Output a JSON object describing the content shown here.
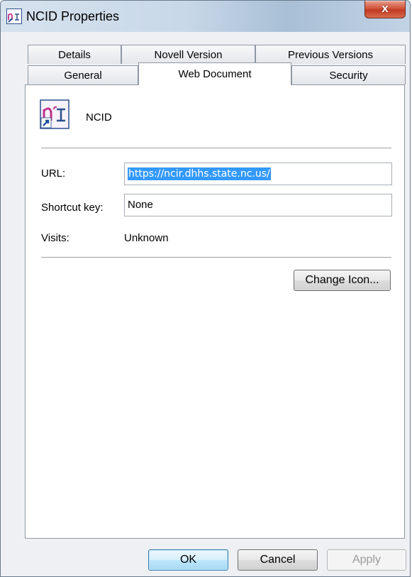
{
  "window": {
    "title": "NCID Properties",
    "close_symbol": "x"
  },
  "tabs": {
    "row1": [
      "Details",
      "Novell Version",
      "Previous Versions"
    ],
    "row2": [
      "General",
      "Web Document",
      "Security"
    ],
    "active": "Web Document"
  },
  "panel": {
    "app_name": "NCID",
    "url_label": "URL:",
    "url_value": "https://ncir.dhhs.state.nc.us/",
    "shortcut_label": "Shortcut key:",
    "shortcut_value": "None",
    "visits_label": "Visits:",
    "visits_value": "Unknown",
    "change_icon_label": "Change Icon..."
  },
  "buttons": {
    "ok": "OK",
    "cancel": "Cancel",
    "apply": "Apply"
  },
  "icons": {
    "title_icon": "ncir-logo-icon",
    "app_icon": "internet-shortcut-icon"
  },
  "colors": {
    "selection": "#3399ff",
    "close_button": "#c8462e",
    "default_button_border": "#3c7fb1"
  }
}
